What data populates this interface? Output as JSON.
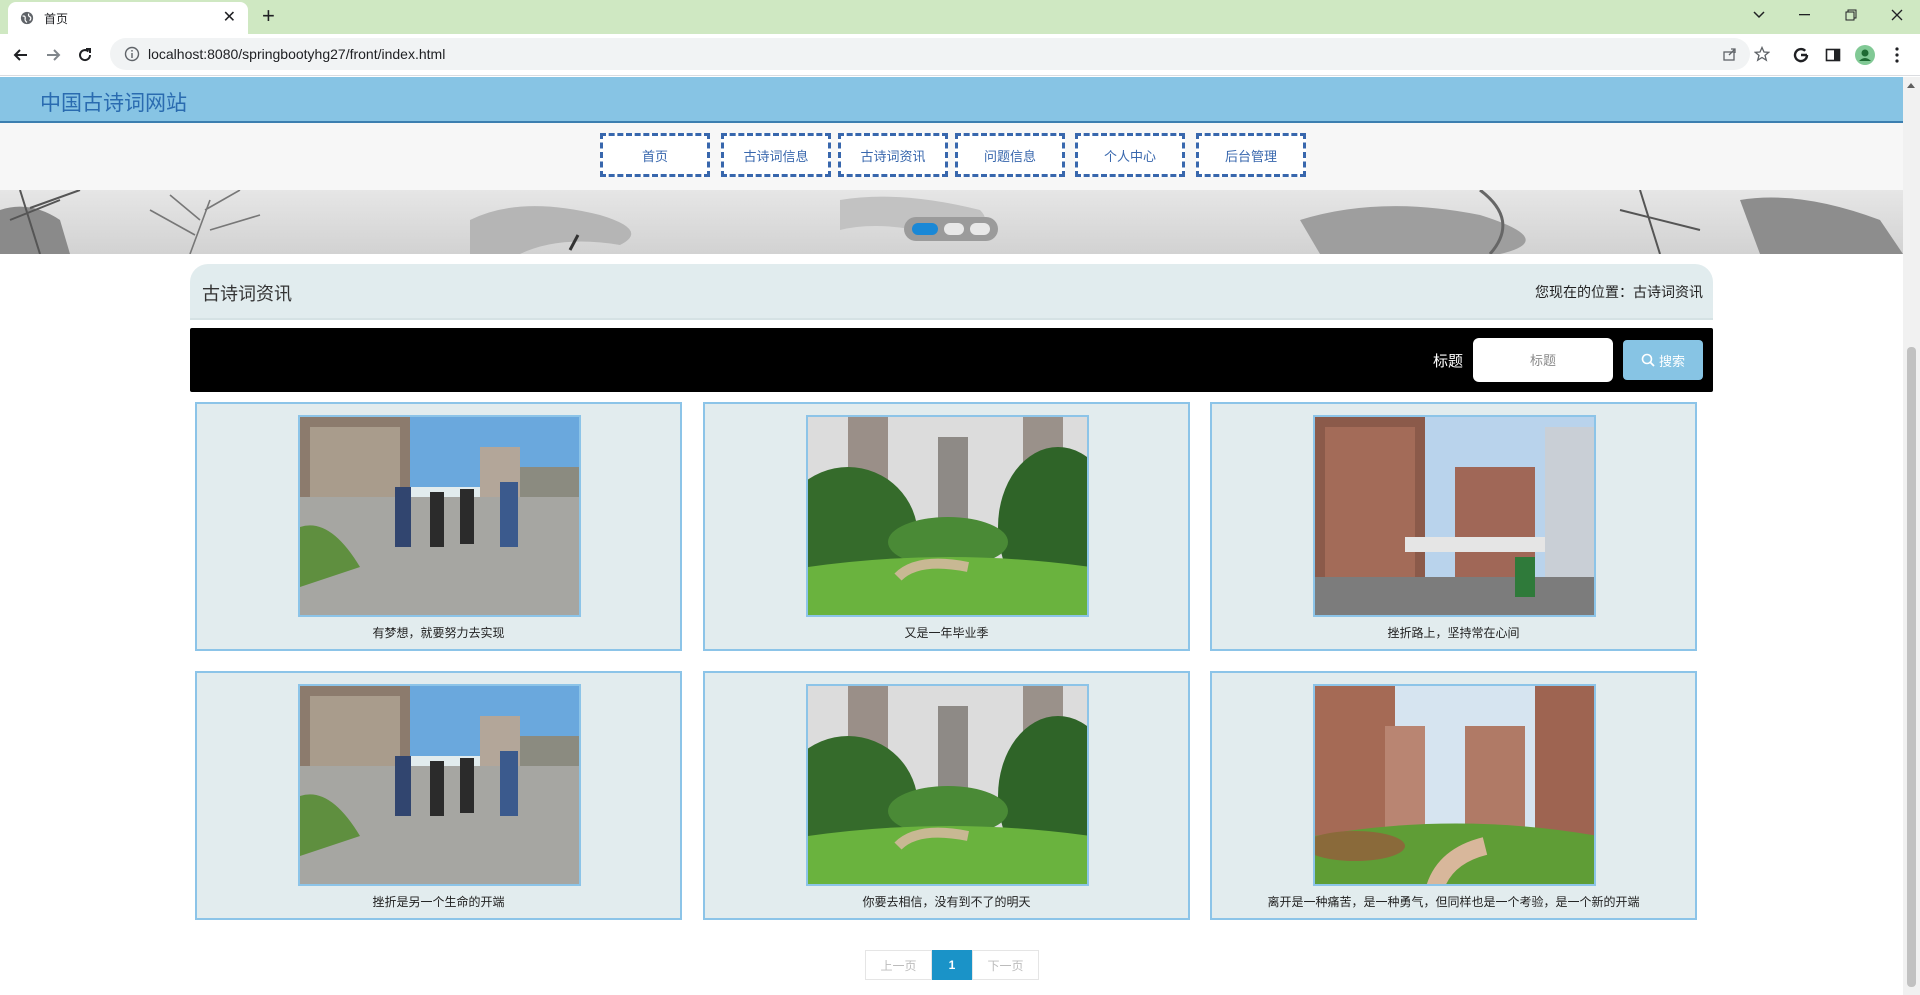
{
  "browser": {
    "tab_title": "首页",
    "url": "localhost:8080/springbootyhg27/front/index.html"
  },
  "site": {
    "title": "中国古诗词网站",
    "nav": [
      "首页",
      "古诗词信息",
      "古诗词资讯",
      "问题信息",
      "个人中心",
      "后台管理"
    ]
  },
  "carousel": {
    "slides": 3,
    "active_index": 0
  },
  "section": {
    "title": "古诗词资讯",
    "breadcrumb_prefix": "您现在的位置：",
    "breadcrumb_current": "古诗词资讯"
  },
  "search": {
    "label": "标题",
    "placeholder": "标题",
    "button_label": "搜索"
  },
  "cards": [
    {
      "caption": "有梦想，就要努力去实现",
      "image": "students-walking-photo"
    },
    {
      "caption": "又是一年毕业季",
      "image": "green-lawn-towers-photo"
    },
    {
      "caption": "挫折路上，坚持常在心间",
      "image": "apartment-gate-photo"
    },
    {
      "caption": "挫折是另一个生命的开端",
      "image": "students-walking-photo"
    },
    {
      "caption": "你要去相信，没有到不了的明天",
      "image": "green-lawn-towers-photo"
    },
    {
      "caption": "离开是一种痛苦，是一种勇气，但同样也是一个考验，是一个新的开端",
      "image": "brick-towers-garden-photo"
    }
  ],
  "pagination": {
    "prev": "上一页",
    "current": "1",
    "next": "下一页"
  }
}
